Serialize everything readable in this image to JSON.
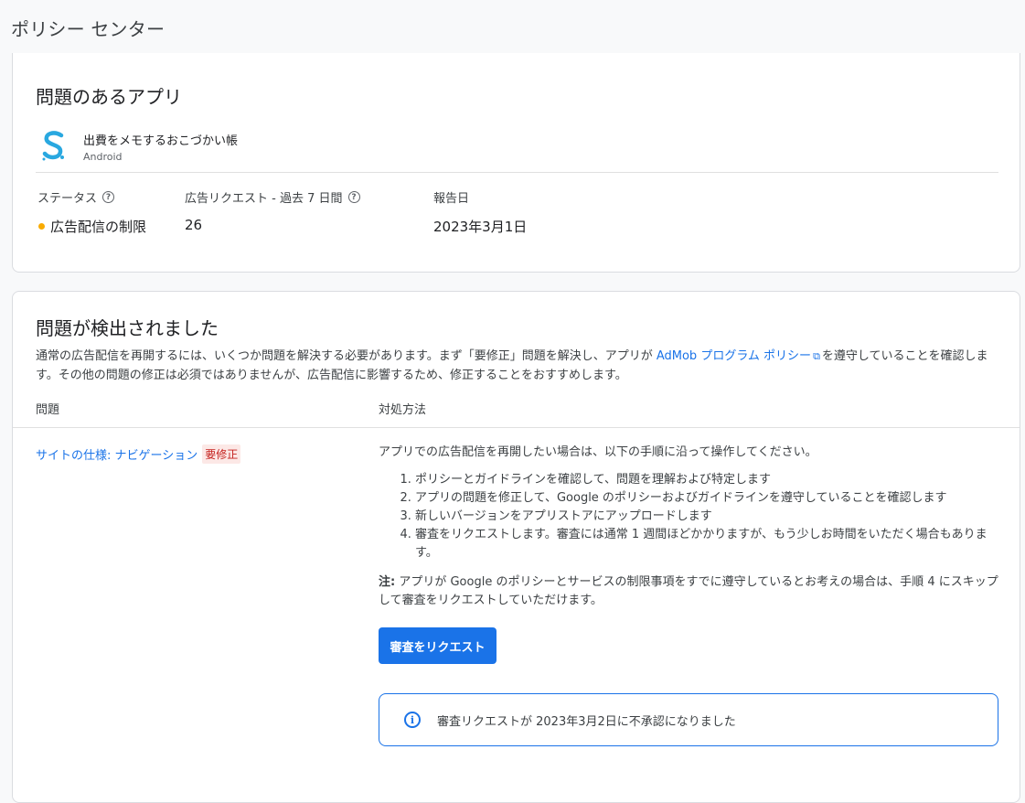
{
  "page_title": "ポリシー センター",
  "app_card": {
    "heading": "問題のあるアプリ",
    "app_name": "出費をメモするおこづかい帳",
    "platform": "Android",
    "app_icon": "app-logo-s",
    "status_label": "ステータス",
    "requests_label": "広告リクエスト - 過去 7 日間",
    "reported_label": "報告日",
    "status_value": "広告配信の制限",
    "status_color": "#f9ab00",
    "requests_value": "26",
    "reported_value": "2023年3月1日"
  },
  "issues_card": {
    "heading": "問題が検出されました",
    "desc_part1": "通常の広告配信を再開するには、いくつか問題を解決する必要があります。まず「要修正」問題を解決し、アプリが ",
    "desc_link": "AdMob プログラム ポリシー",
    "desc_part2": "を遵守していることを確認します。その他の問題の修正は必須ではありませんが、広告配信に影響するため、修正することをおすすめします。",
    "col_issue": "問題",
    "col_fix": "対処方法",
    "issue_name": "サイトの仕様: ナビゲーション",
    "issue_badge": "要修正",
    "fix_intro": "アプリでの広告配信を再開したい場合は、以下の手順に沿って操作してください。",
    "steps": [
      "ポリシーとガイドラインを確認して、問題を理解および特定します",
      "アプリの問題を修正して、Google のポリシーおよびガイドラインを遵守していることを確認します",
      "新しいバージョンをアプリストアにアップロードします",
      "審査をリクエストします。審査には通常 1 週間ほどかかりますが、もう少しお時間をいただく場合もあります。"
    ],
    "note_label": "注:",
    "note_text": " アプリが Google のポリシーとサービスの制限事項をすでに遵守しているとお考えの場合は、手順 4 にスキップして審査をリクエストしていただけます。",
    "button_label": "審査をリクエスト",
    "info_text": "審査リクエストが 2023年3月2日に不承認になりました"
  }
}
